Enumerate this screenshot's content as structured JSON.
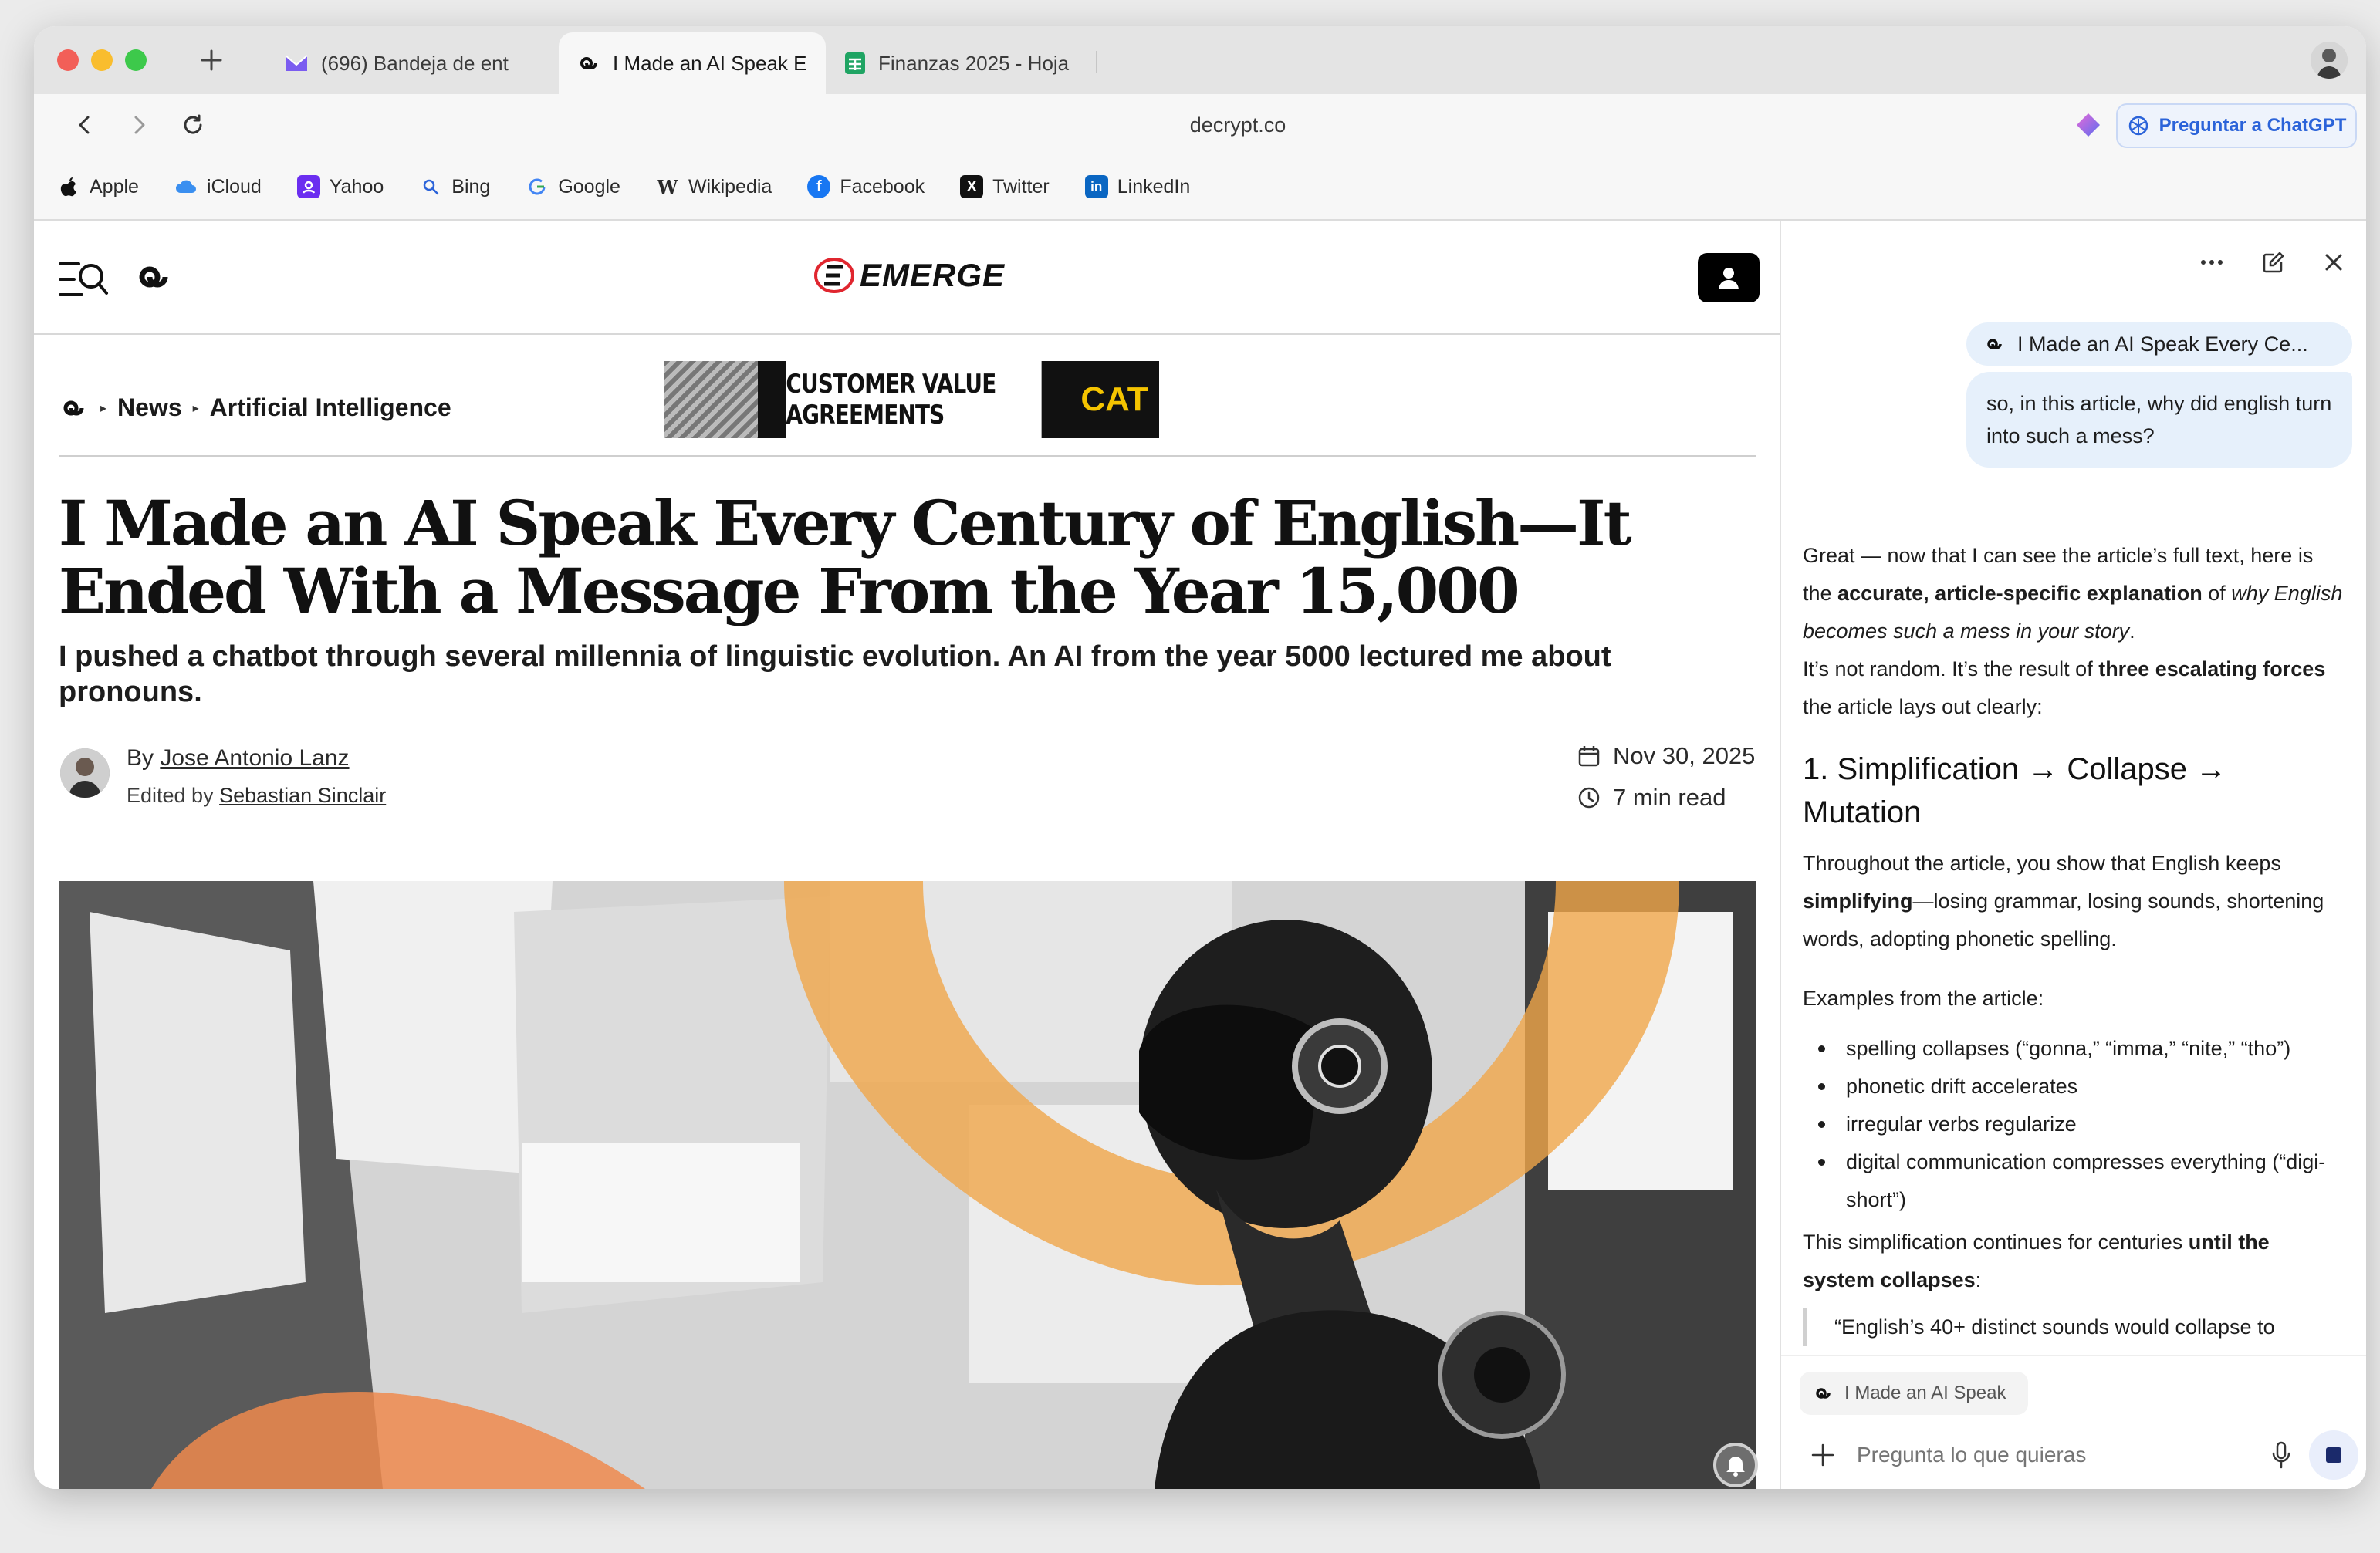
{
  "browser": {
    "tabs": [
      {
        "label": "(696) Bandeja de ent",
        "icon": "mail-icon",
        "active": false
      },
      {
        "label": "I Made an AI Speak E",
        "icon": "decrypt-icon",
        "active": true
      },
      {
        "label": "Finanzas 2025 - Hoja",
        "icon": "sheets-icon",
        "active": false
      }
    ],
    "url": "decrypt.co",
    "chatgpt_button": "Preguntar a ChatGPT",
    "bookmarks": [
      {
        "label": "Apple",
        "icon": "apple-icon"
      },
      {
        "label": "iCloud",
        "icon": "cloud-icon"
      },
      {
        "label": "Yahoo",
        "icon": "yahoo-icon"
      },
      {
        "label": "Bing",
        "icon": "search-icon"
      },
      {
        "label": "Google",
        "icon": "google-icon"
      },
      {
        "label": "Wikipedia",
        "icon": "wikipedia-icon"
      },
      {
        "label": "Facebook",
        "icon": "facebook-icon"
      },
      {
        "label": "Twitter",
        "icon": "x-icon"
      },
      {
        "label": "LinkedIn",
        "icon": "linkedin-icon"
      }
    ]
  },
  "site": {
    "brand": "EMERGE",
    "breadcrumb": [
      "News",
      "Artificial Intelligence"
    ],
    "ad_text": "CUSTOMER VALUE AGREEMENTS",
    "ad_brand": "CAT"
  },
  "article": {
    "headline": "I Made an AI Speak Every Century of English—It Ended With a Message From the Year 15,000",
    "dek": "I pushed a chatbot through several millennia of linguistic evolution. An AI from the year 5000 lectured me about pronouns.",
    "by_prefix": "By",
    "author": "Jose Antonio Lanz",
    "edited_prefix": "Edited by",
    "editor": "Sebastian Sinclair",
    "date": "Nov 30, 2025",
    "read_time": "7 min read"
  },
  "sidebar": {
    "context_title": "I Made an AI Speak Every Ce...",
    "user_message": "so, in this article, why did english turn into such a mess?",
    "answer": {
      "p1_a": "Great — now that I can see the article’s full text, here is the ",
      "p1_b": "accurate, article-specific explanation",
      "p1_c": " of ",
      "p1_d": "why English becomes such a mess in your story",
      "p1_e": ".",
      "p2_a": "It’s not random. It’s the result of ",
      "p2_b": "three escalating forces",
      "p2_c": " the article lays out clearly:",
      "h1": "1. Simplification → Collapse → Mutation",
      "p3_a": "Throughout the article, you show that English keeps ",
      "p3_b": "simplifying",
      "p3_c": "—losing grammar, losing sounds, shortening words, adopting phonetic spelling.",
      "p4": "Examples from the article:",
      "bullets": [
        "spelling collapses (“gonna,” “imma,” “nite,” “tho”)",
        "phonetic drift accelerates",
        "irregular verbs regularize",
        "digital communication compresses everything (“digi-short”)"
      ],
      "p5_a": "This simplification continues for centuries ",
      "p5_b": "until the system collapses",
      "p5_c": ":",
      "quote": "“English’s 40+ distinct sounds would collapse to"
    },
    "context_chip": "I Made an AI Speak",
    "composer_placeholder": "Pregunta lo que quieras"
  }
}
